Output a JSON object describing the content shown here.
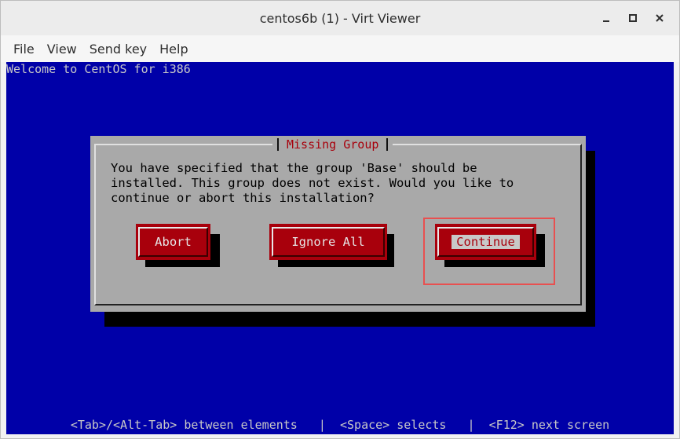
{
  "window": {
    "title": "centos6b (1) - Virt Viewer",
    "controls": {
      "minimize_icon": "minimize-icon",
      "maximize_icon": "maximize-icon",
      "close_icon": "close-icon"
    }
  },
  "menubar": {
    "items": [
      "File",
      "View",
      "Send key",
      "Help"
    ]
  },
  "console": {
    "welcome": "Welcome to CentOS for i386",
    "footer": "<Tab>/<Alt-Tab> between elements   |  <Space> selects   |  <F12> next screen",
    "background_color": "#0000a8"
  },
  "dialog": {
    "title": "Missing Group",
    "message_lines": [
      "You have specified that the group 'Base' should be",
      "installed. This group does not exist. Would you like to",
      "continue or abort this installation?"
    ],
    "buttons": {
      "abort": "Abort",
      "ignore_all": "Ignore All",
      "continue": "Continue"
    },
    "focused_button": "Continue",
    "accent_color": "#a8000c",
    "highlight_color": "#e85050"
  }
}
